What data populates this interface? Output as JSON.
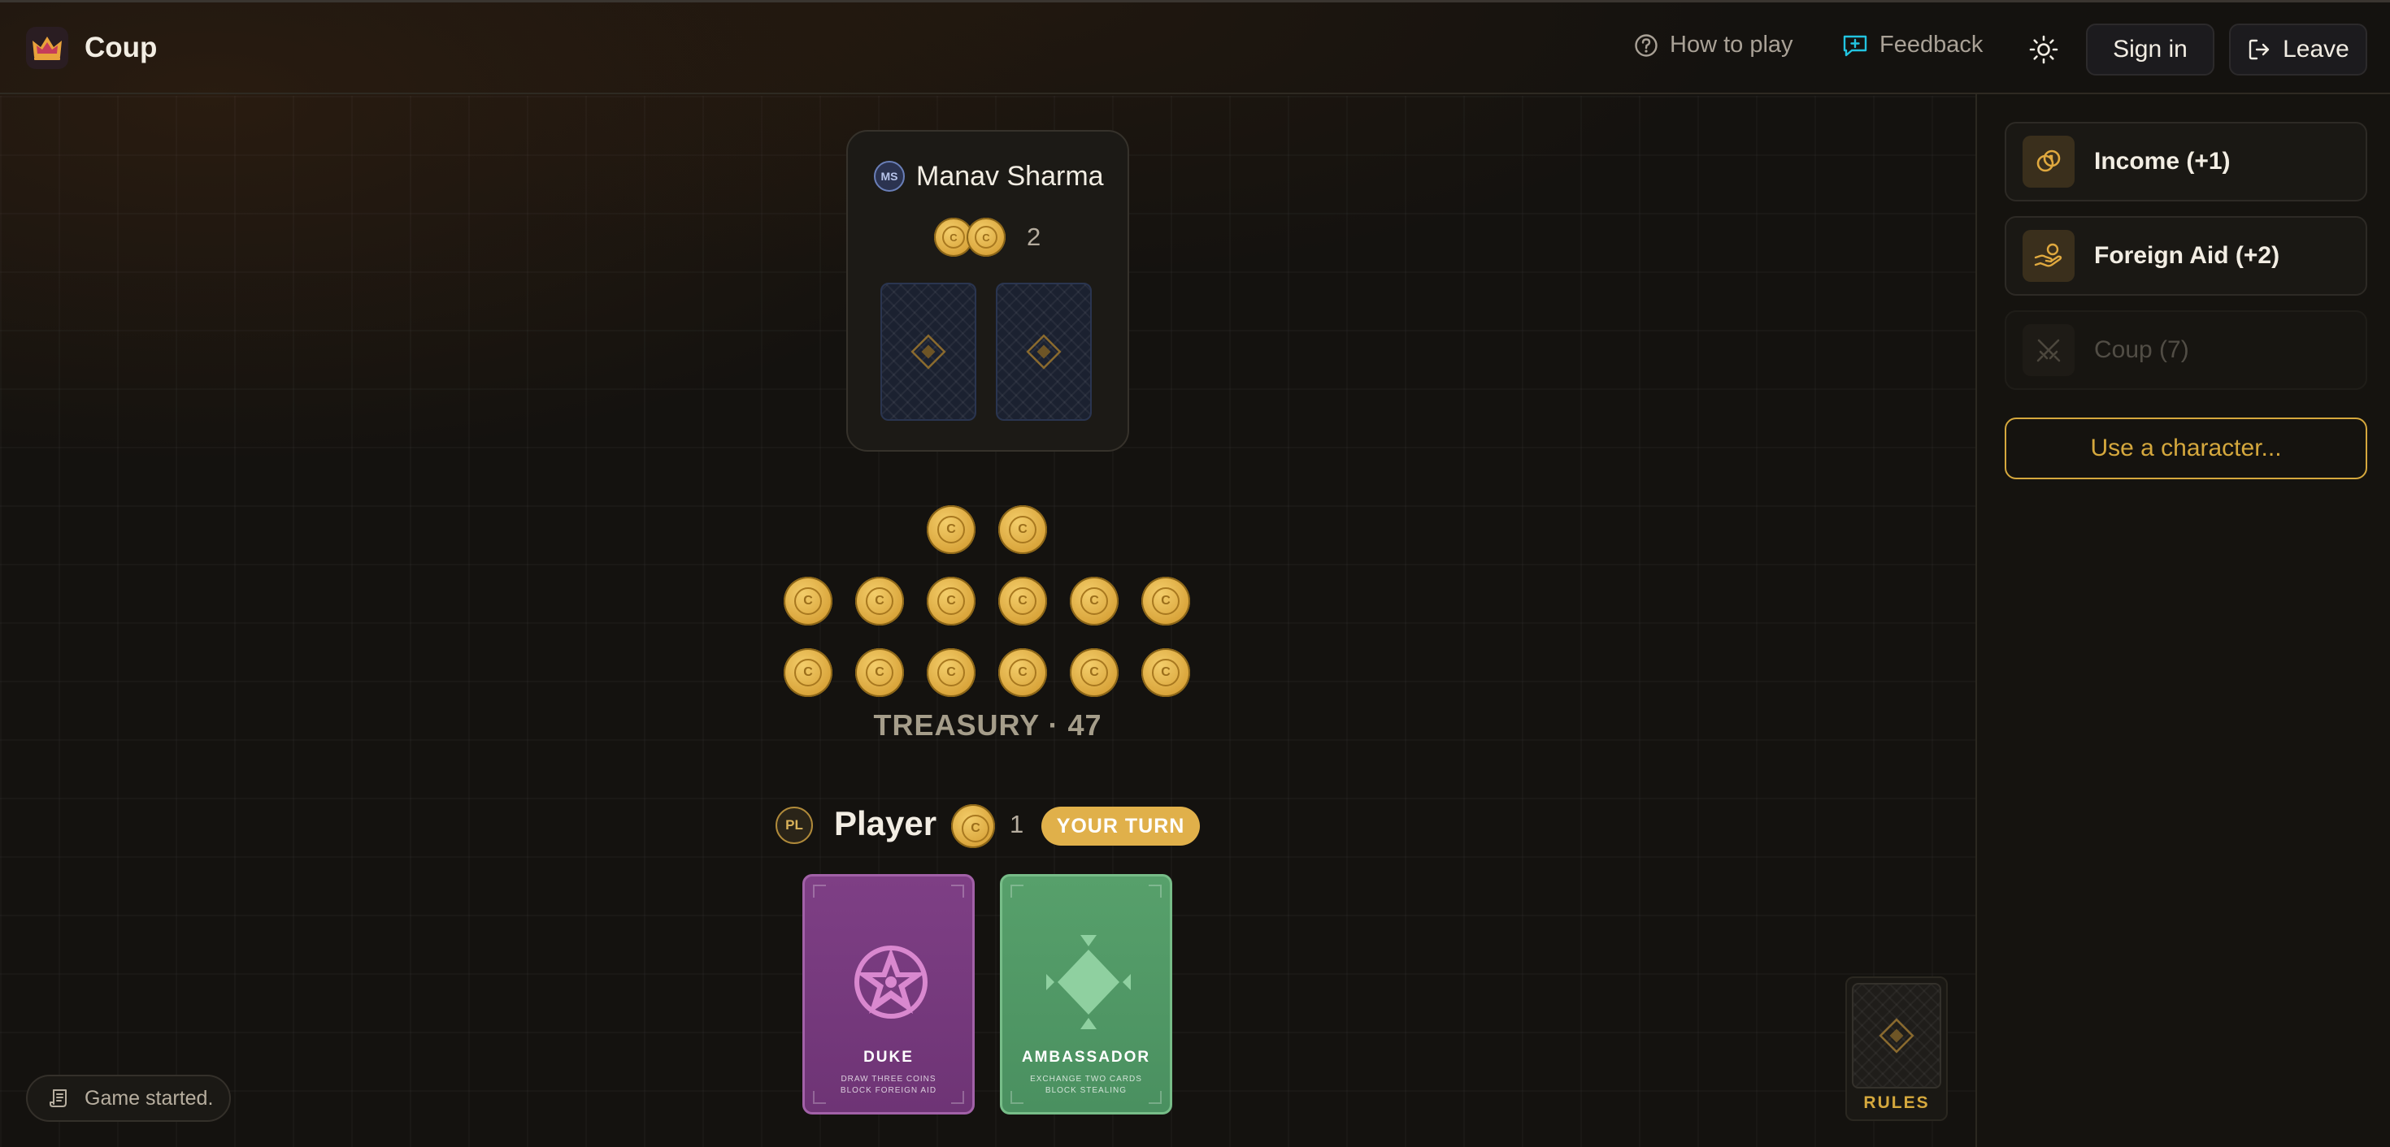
{
  "header": {
    "app_name": "Coup",
    "how_to_play": "How to play",
    "feedback": "Feedback",
    "sign_in": "Sign in",
    "leave": "Leave"
  },
  "opponent": {
    "initials": "MS",
    "name": "Manav Sharma",
    "coins": "2",
    "hidden_cards": 2
  },
  "treasury": {
    "label": "TREASURY · 47",
    "coins_shown": 14
  },
  "player": {
    "initials": "PL",
    "name": "Player",
    "coins": "1",
    "turn_badge": "YOUR TURN",
    "cards": [
      {
        "name": "DUKE",
        "line1": "DRAW THREE COINS",
        "line2": "BLOCK FOREIGN AID",
        "color": "#7a3c80"
      },
      {
        "name": "AMBASSADOR",
        "line1": "EXCHANGE TWO CARDS",
        "line2": "BLOCK STEALING",
        "color": "#539a67"
      }
    ]
  },
  "actions": {
    "income": "Income (+1)",
    "foreign_aid": "Foreign Aid (+2)",
    "coup": "Coup (7)",
    "use_character": "Use a character..."
  },
  "deck": {
    "label": "RULES"
  },
  "log": {
    "text": "Game started."
  },
  "colors": {
    "accent": "#d5a83d",
    "link": "#22c4e0",
    "background": "#14120f"
  }
}
